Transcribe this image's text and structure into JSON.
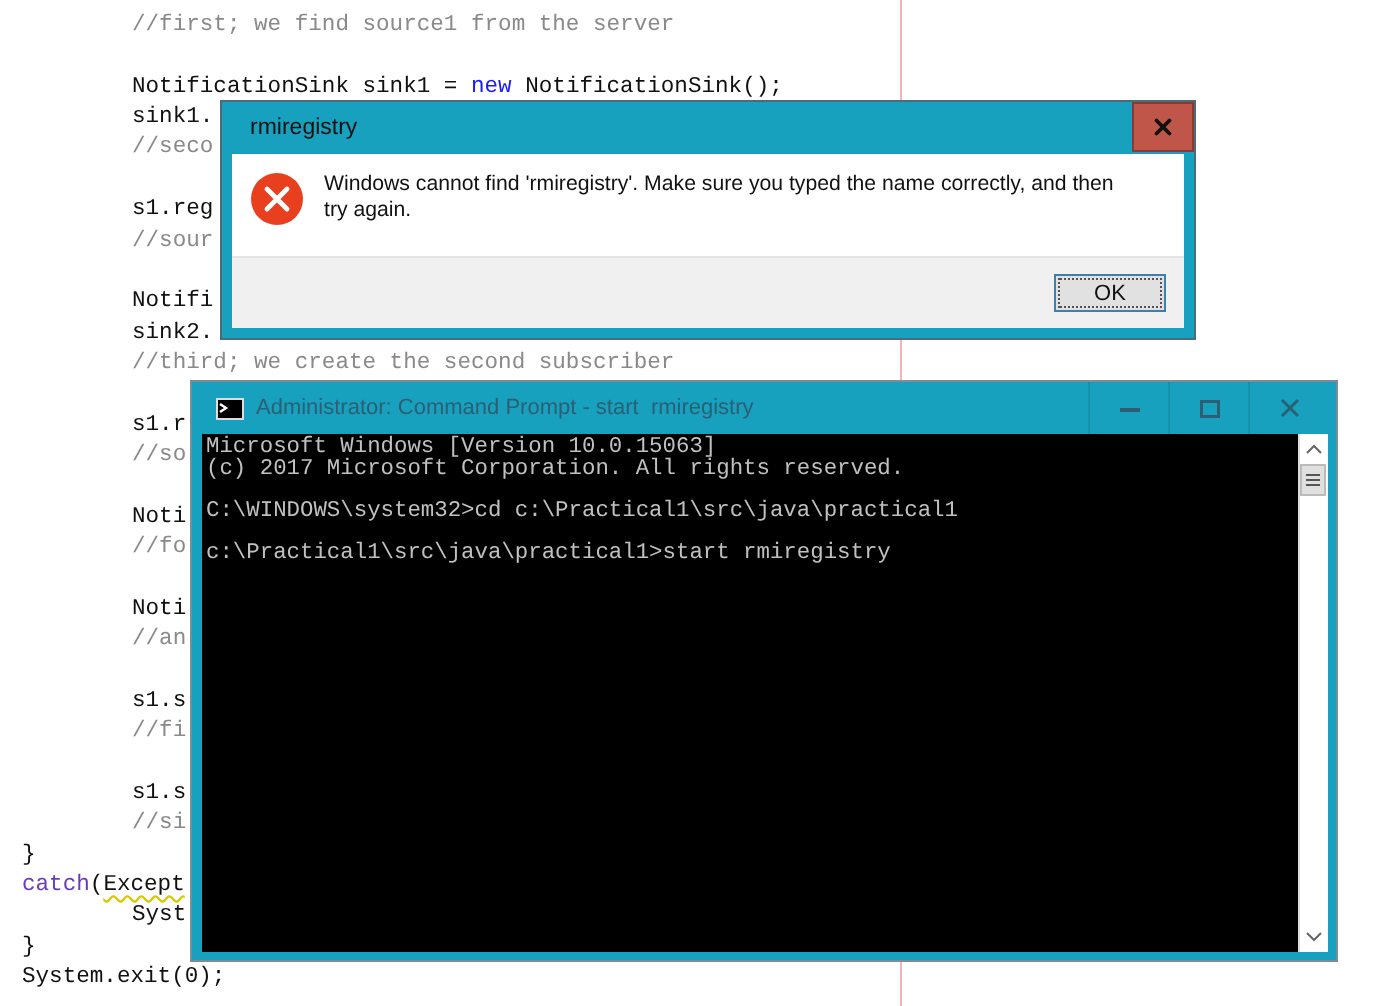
{
  "editor": {
    "lines": [
      {
        "kind": "code",
        "indented": true,
        "parts": [
          {
            "kind": "comment",
            "text": "//first; we find source1 from the server"
          }
        ]
      },
      {
        "kind": "blank"
      },
      {
        "kind": "code",
        "indented": true,
        "parts": [
          {
            "kind": "plain",
            "text": "NotificationSink sink1 = "
          },
          {
            "kind": "keyword",
            "text": "new"
          },
          {
            "kind": "plain",
            "text": " NotificationSink();"
          }
        ]
      },
      {
        "kind": "code",
        "indented": true,
        "parts": [
          {
            "kind": "plain",
            "text": "sink1."
          }
        ]
      },
      {
        "kind": "code",
        "indented": true,
        "parts": [
          {
            "kind": "comment",
            "text": "//seco"
          }
        ]
      },
      {
        "kind": "blank"
      },
      {
        "kind": "code",
        "indented": true,
        "parts": [
          {
            "kind": "plain",
            "text": "s1.reg"
          }
        ]
      },
      {
        "kind": "code",
        "indented": true,
        "parts": [
          {
            "kind": "comment",
            "text": "//sour"
          }
        ]
      },
      {
        "kind": "blank"
      },
      {
        "kind": "code",
        "indented": true,
        "parts": [
          {
            "kind": "plain",
            "text": "Notifi"
          }
        ]
      },
      {
        "kind": "code",
        "indented": true,
        "parts": [
          {
            "kind": "plain",
            "text": "sink2."
          }
        ]
      },
      {
        "kind": "code",
        "indented": true,
        "parts": [
          {
            "kind": "comment",
            "text": "//third; we create the second subscriber"
          }
        ]
      },
      {
        "kind": "blank"
      },
      {
        "kind": "code",
        "indented": true,
        "parts": [
          {
            "kind": "plain",
            "text": "s1.r"
          }
        ]
      },
      {
        "kind": "code",
        "indented": true,
        "parts": [
          {
            "kind": "comment",
            "text": "//so"
          }
        ]
      },
      {
        "kind": "blank"
      },
      {
        "kind": "code",
        "indented": true,
        "parts": [
          {
            "kind": "plain",
            "text": "Noti"
          }
        ]
      },
      {
        "kind": "code",
        "indented": true,
        "parts": [
          {
            "kind": "comment",
            "text": "//fo"
          }
        ]
      },
      {
        "kind": "blank"
      },
      {
        "kind": "code",
        "indented": true,
        "parts": [
          {
            "kind": "plain",
            "text": "Noti"
          }
        ]
      },
      {
        "kind": "code",
        "indented": true,
        "parts": [
          {
            "kind": "comment",
            "text": "//an"
          }
        ]
      },
      {
        "kind": "blank"
      },
      {
        "kind": "code",
        "indented": true,
        "parts": [
          {
            "kind": "plain",
            "text": "s1.s"
          }
        ]
      },
      {
        "kind": "code",
        "indented": true,
        "parts": [
          {
            "kind": "comment",
            "text": "//fi"
          }
        ]
      },
      {
        "kind": "blank"
      },
      {
        "kind": "code",
        "indented": true,
        "parts": [
          {
            "kind": "plain",
            "text": "s1.s"
          }
        ]
      },
      {
        "kind": "code",
        "indented": true,
        "parts": [
          {
            "kind": "comment",
            "text": "//si"
          }
        ]
      },
      {
        "kind": "code",
        "indented": false,
        "parts": [
          {
            "kind": "plain",
            "text": "}"
          }
        ]
      },
      {
        "kind": "code",
        "indented": false,
        "parts": [
          {
            "kind": "keyword2",
            "text": "catch"
          },
          {
            "kind": "plain",
            "text": "("
          },
          {
            "kind": "warning",
            "text": "Except"
          }
        ]
      },
      {
        "kind": "code",
        "indented": true,
        "parts": [
          {
            "kind": "plain",
            "text": "Syst"
          }
        ]
      },
      {
        "kind": "code",
        "indented": false,
        "parts": [
          {
            "kind": "plain",
            "text": "}"
          }
        ]
      },
      {
        "kind": "code",
        "indented": false,
        "parts": [
          {
            "kind": "plain",
            "text": "System.exit(0);"
          }
        ]
      }
    ]
  },
  "dialog": {
    "title": "rmiregistry",
    "message": "Windows cannot find 'rmiregistry'. Make sure you typed the name correctly, and then try again.",
    "button": "OK"
  },
  "console": {
    "title": "Administrator: Command Prompt - start  rmiregistry",
    "lines": [
      {
        "text": "Microsoft Windows [Version 10.0.15063]"
      },
      {
        "text": "(c) 2017 Microsoft Corporation. All rights reserved."
      },
      {
        "text": "C:\\WINDOWS\\system32>cd c:\\Practical1\\src\\java\\practical1",
        "gap_before": true
      },
      {
        "text": "c:\\Practical1\\src\\java\\practical1>start rmiregistry",
        "gap_before": true
      }
    ]
  }
}
